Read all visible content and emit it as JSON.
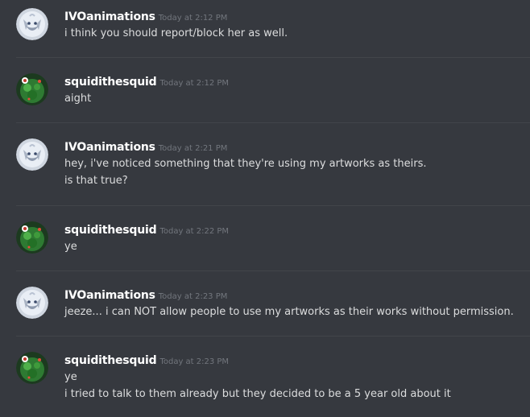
{
  "messages": [
    {
      "author": "IVOanimations",
      "avatar_icon": "white-wolf-avatar-icon",
      "timestamp": "Today at 2:12 PM",
      "lines": [
        "i think you should report/block her as well."
      ]
    },
    {
      "author": "squidithesquid",
      "avatar_icon": "green-creature-avatar-icon",
      "timestamp": "Today at 2:12 PM",
      "lines": [
        "aight"
      ]
    },
    {
      "author": "IVOanimations",
      "avatar_icon": "white-wolf-avatar-icon",
      "timestamp": "Today at 2:21 PM",
      "lines": [
        "hey, i've noticed something that they're using my artworks as theirs.",
        "is that true?"
      ]
    },
    {
      "author": "squidithesquid",
      "avatar_icon": "green-creature-avatar-icon",
      "timestamp": "Today at 2:22 PM",
      "lines": [
        "ye"
      ]
    },
    {
      "author": "IVOanimations",
      "avatar_icon": "white-wolf-avatar-icon",
      "timestamp": "Today at 2:23 PM",
      "lines": [
        "jeeze... i can NOT allow people to use my artworks as their works without permission."
      ]
    },
    {
      "author": "squidithesquid",
      "avatar_icon": "green-creature-avatar-icon",
      "timestamp": "Today at 2:23 PM",
      "lines": [
        "ye",
        "i tried to talk to them already but they decided to be a 5 year old about it"
      ]
    }
  ],
  "colors": {
    "background": "#36393f",
    "username": "#ffffff",
    "timestamp": "#72767d",
    "message_text": "#dcddde",
    "divider": "#42454a"
  }
}
